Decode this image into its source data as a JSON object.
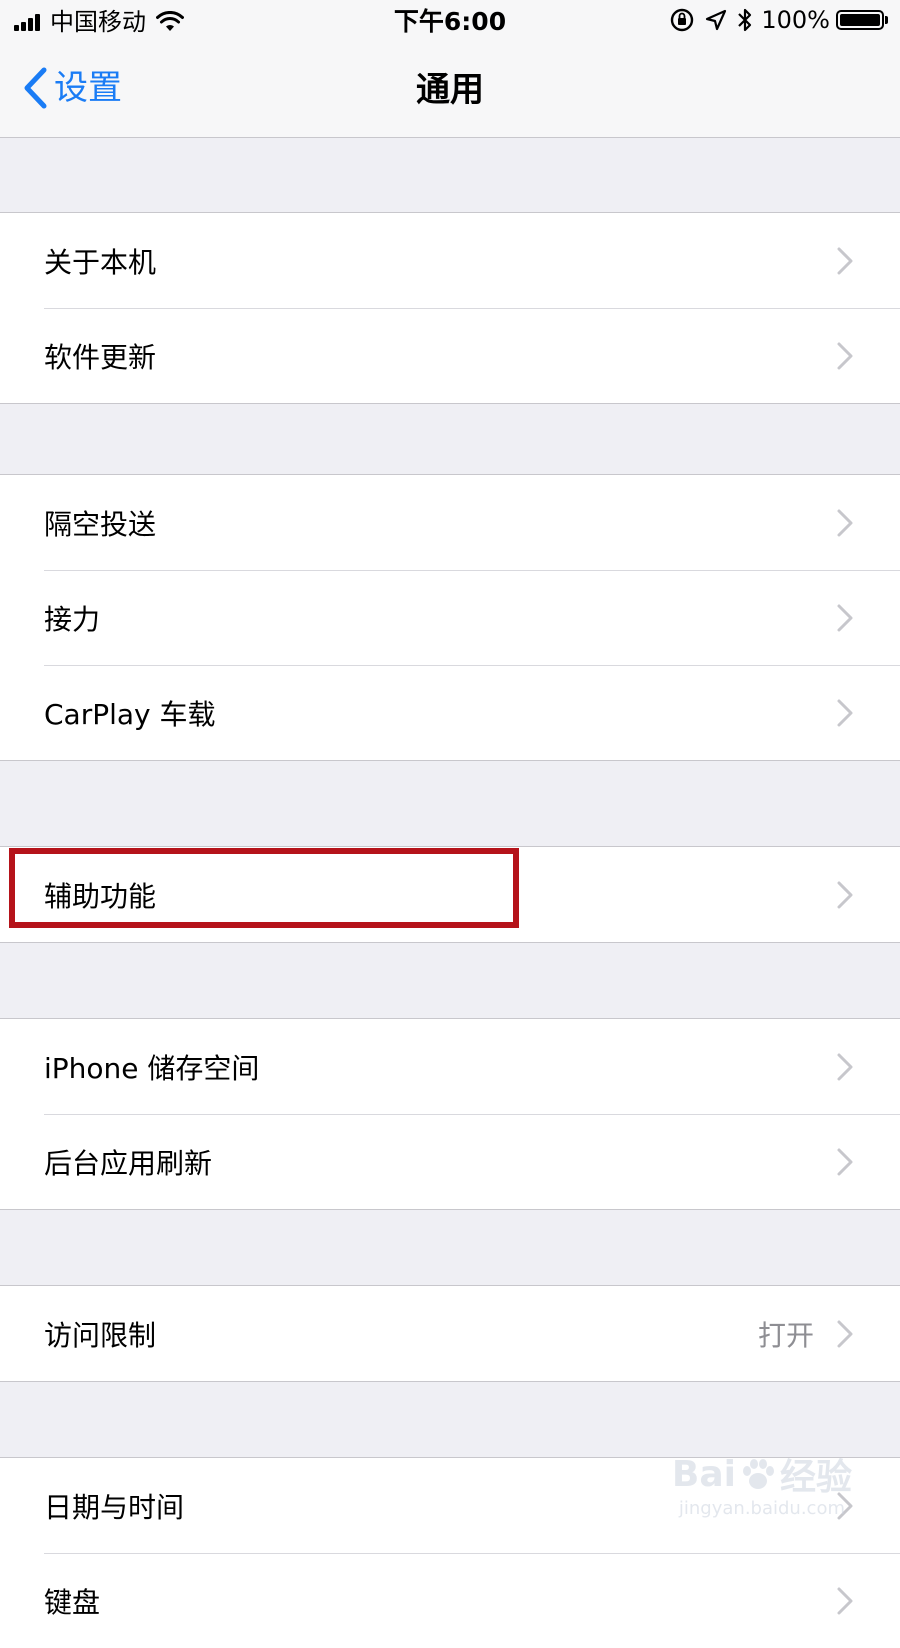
{
  "status_bar": {
    "carrier": "中国移动",
    "time": "下午6:00",
    "battery_pct": "100%",
    "battery_level": 1.0,
    "icons": [
      "signal-icon",
      "wifi-icon",
      "orientation-lock-icon",
      "location-icon",
      "bluetooth-icon",
      "battery-icon"
    ]
  },
  "nav": {
    "back_label": "设置",
    "title": "通用"
  },
  "groups": [
    {
      "items": [
        {
          "label": "关于本机"
        },
        {
          "label": "软件更新"
        }
      ]
    },
    {
      "items": [
        {
          "label": "隔空投送"
        },
        {
          "label": "接力"
        },
        {
          "label": "CarPlay 车载"
        }
      ]
    },
    {
      "items": [
        {
          "label": "辅助功能",
          "highlighted": true
        }
      ]
    },
    {
      "items": [
        {
          "label": "iPhone 储存空间"
        },
        {
          "label": "后台应用刷新"
        }
      ]
    },
    {
      "items": [
        {
          "label": "访问限制",
          "value": "打开"
        }
      ]
    },
    {
      "items": [
        {
          "label": "日期与时间"
        },
        {
          "label": "键盘"
        }
      ]
    }
  ],
  "watermark": {
    "logo_text_left": "Bai",
    "logo_text_right": "经验",
    "url": "jingyan.baidu.com"
  },
  "colors": {
    "accent": "#1a7cf5",
    "highlight": "#b5131a",
    "background": "#efeff4",
    "secondary_text": "#8e8e93"
  }
}
